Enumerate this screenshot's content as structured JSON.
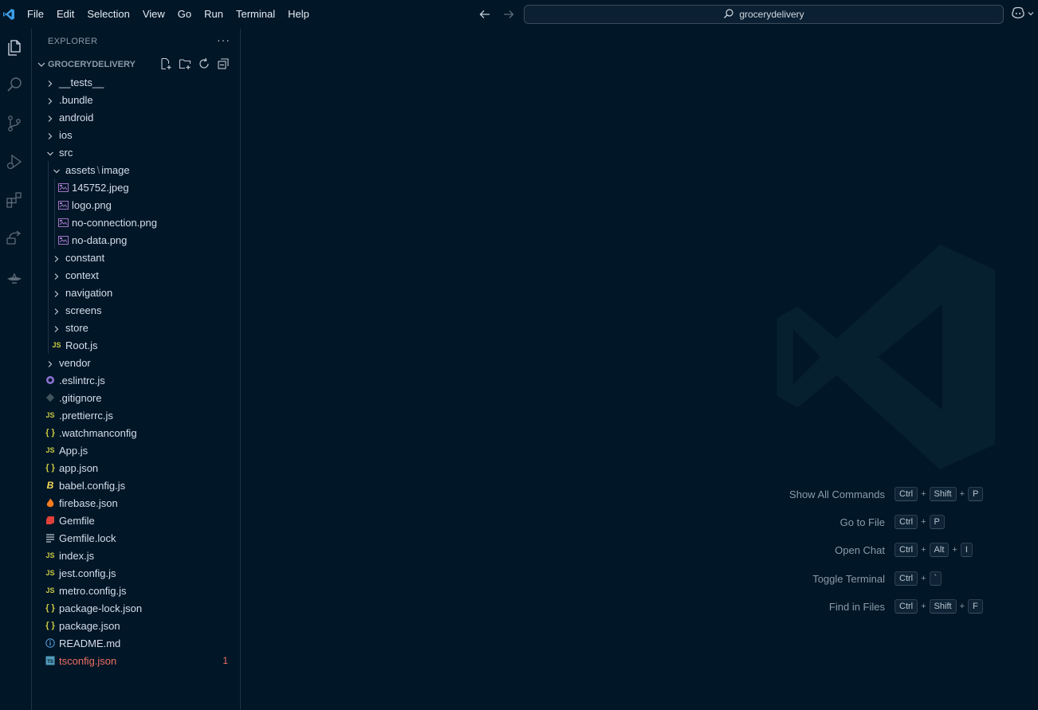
{
  "menubar": {
    "items": [
      "File",
      "Edit",
      "Selection",
      "View",
      "Go",
      "Run",
      "Terminal",
      "Help"
    ]
  },
  "search": {
    "text": "grocerydelivery"
  },
  "explorer": {
    "header": "EXPLORER",
    "more": "···",
    "root_title": "GROCERYDELIVERY",
    "tree": [
      {
        "label": "__tests__",
        "kind": "folder",
        "expanded": false,
        "depth": 0
      },
      {
        "label": ".bundle",
        "kind": "folder",
        "expanded": false,
        "depth": 0
      },
      {
        "label": "android",
        "kind": "folder",
        "expanded": false,
        "depth": 0
      },
      {
        "label": "ios",
        "kind": "folder",
        "expanded": false,
        "depth": 0
      },
      {
        "label": "src",
        "kind": "folder",
        "expanded": true,
        "depth": 0
      },
      {
        "label": "assets",
        "label2": "image",
        "kind": "folder",
        "expanded": true,
        "depth": 1
      },
      {
        "label": "145752.jpeg",
        "kind": "image",
        "depth": 2
      },
      {
        "label": "logo.png",
        "kind": "image",
        "depth": 2
      },
      {
        "label": "no-connection.png",
        "kind": "image",
        "depth": 2
      },
      {
        "label": "no-data.png",
        "kind": "image",
        "depth": 2
      },
      {
        "label": "constant",
        "kind": "folder",
        "expanded": false,
        "depth": 1
      },
      {
        "label": "context",
        "kind": "folder",
        "expanded": false,
        "depth": 1
      },
      {
        "label": "navigation",
        "kind": "folder",
        "expanded": false,
        "depth": 1
      },
      {
        "label": "screens",
        "kind": "folder",
        "expanded": false,
        "depth": 1
      },
      {
        "label": "store",
        "kind": "folder",
        "expanded": false,
        "depth": 1
      },
      {
        "label": "Root.js",
        "kind": "js",
        "depth": 1
      },
      {
        "label": "vendor",
        "kind": "folder",
        "expanded": false,
        "depth": 0
      },
      {
        "label": ".eslintrc.js",
        "kind": "eslint",
        "depth": 0
      },
      {
        "label": ".gitignore",
        "kind": "git",
        "depth": 0
      },
      {
        "label": ".prettierrc.js",
        "kind": "js",
        "depth": 0
      },
      {
        "label": ".watchmanconfig",
        "kind": "json",
        "depth": 0
      },
      {
        "label": "App.js",
        "kind": "js",
        "depth": 0
      },
      {
        "label": "app.json",
        "kind": "json",
        "depth": 0
      },
      {
        "label": "babel.config.js",
        "kind": "babel",
        "depth": 0
      },
      {
        "label": "firebase.json",
        "kind": "firebase",
        "depth": 0
      },
      {
        "label": "Gemfile",
        "kind": "ruby",
        "depth": 0
      },
      {
        "label": "Gemfile.lock",
        "kind": "lock",
        "depth": 0
      },
      {
        "label": "index.js",
        "kind": "js",
        "depth": 0
      },
      {
        "label": "jest.config.js",
        "kind": "js",
        "depth": 0
      },
      {
        "label": "metro.config.js",
        "kind": "js",
        "depth": 0
      },
      {
        "label": "package-lock.json",
        "kind": "json",
        "depth": 0
      },
      {
        "label": "package.json",
        "kind": "json",
        "depth": 0
      },
      {
        "label": "README.md",
        "kind": "info",
        "depth": 0
      },
      {
        "label": "tsconfig.json",
        "kind": "ts",
        "depth": 0,
        "error": true,
        "badge": "1"
      }
    ]
  },
  "shortcuts": [
    {
      "label": "Show All Commands",
      "keys": [
        "Ctrl",
        "Shift",
        "P"
      ]
    },
    {
      "label": "Go to File",
      "keys": [
        "Ctrl",
        "P"
      ]
    },
    {
      "label": "Open Chat",
      "keys": [
        "Ctrl",
        "Alt",
        "I"
      ]
    },
    {
      "label": "Toggle Terminal",
      "keys": [
        "Ctrl",
        "`"
      ]
    },
    {
      "label": "Find in Files",
      "keys": [
        "Ctrl",
        "Shift",
        "F"
      ]
    }
  ],
  "colors": {
    "background": "#011627",
    "js_yellow": "#cbcb41",
    "json_yellow": "#cbcb41",
    "image_purple": "#a074c4",
    "error_red": "#ef6f62",
    "vscode_blue": "#3c9ee5"
  }
}
